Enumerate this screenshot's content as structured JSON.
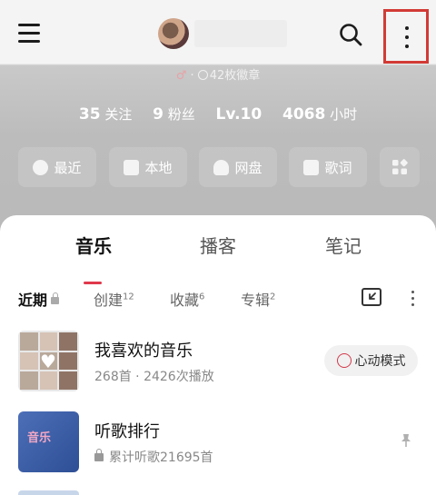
{
  "badge_line": {
    "badge_count": "42枚徽章"
  },
  "stats": [
    {
      "num": "35",
      "label": "关注"
    },
    {
      "num": "9",
      "label": "粉丝"
    },
    {
      "num": "Lv.10",
      "label": ""
    },
    {
      "num": "4068",
      "label": "小时"
    }
  ],
  "quick": [
    "最近",
    "本地",
    "网盘",
    "歌词"
  ],
  "tabs": [
    "音乐",
    "播客",
    "笔记"
  ],
  "subtabs": {
    "recent": "近期",
    "created": "创建",
    "created_count": "12",
    "collected": "收藏",
    "collected_count": "6",
    "albums": "专辑",
    "albums_count": "2"
  },
  "playlists": [
    {
      "title": "我喜欢的音乐",
      "subtitle": "268首 · 2426次播放",
      "action": "心动模式"
    },
    {
      "title": "听歌排行",
      "subtitle": "累计听歌21695首",
      "cover_text": "音乐"
    }
  ],
  "colors": {
    "accent": "#e0384b",
    "highlight_border": "#d23a35"
  }
}
